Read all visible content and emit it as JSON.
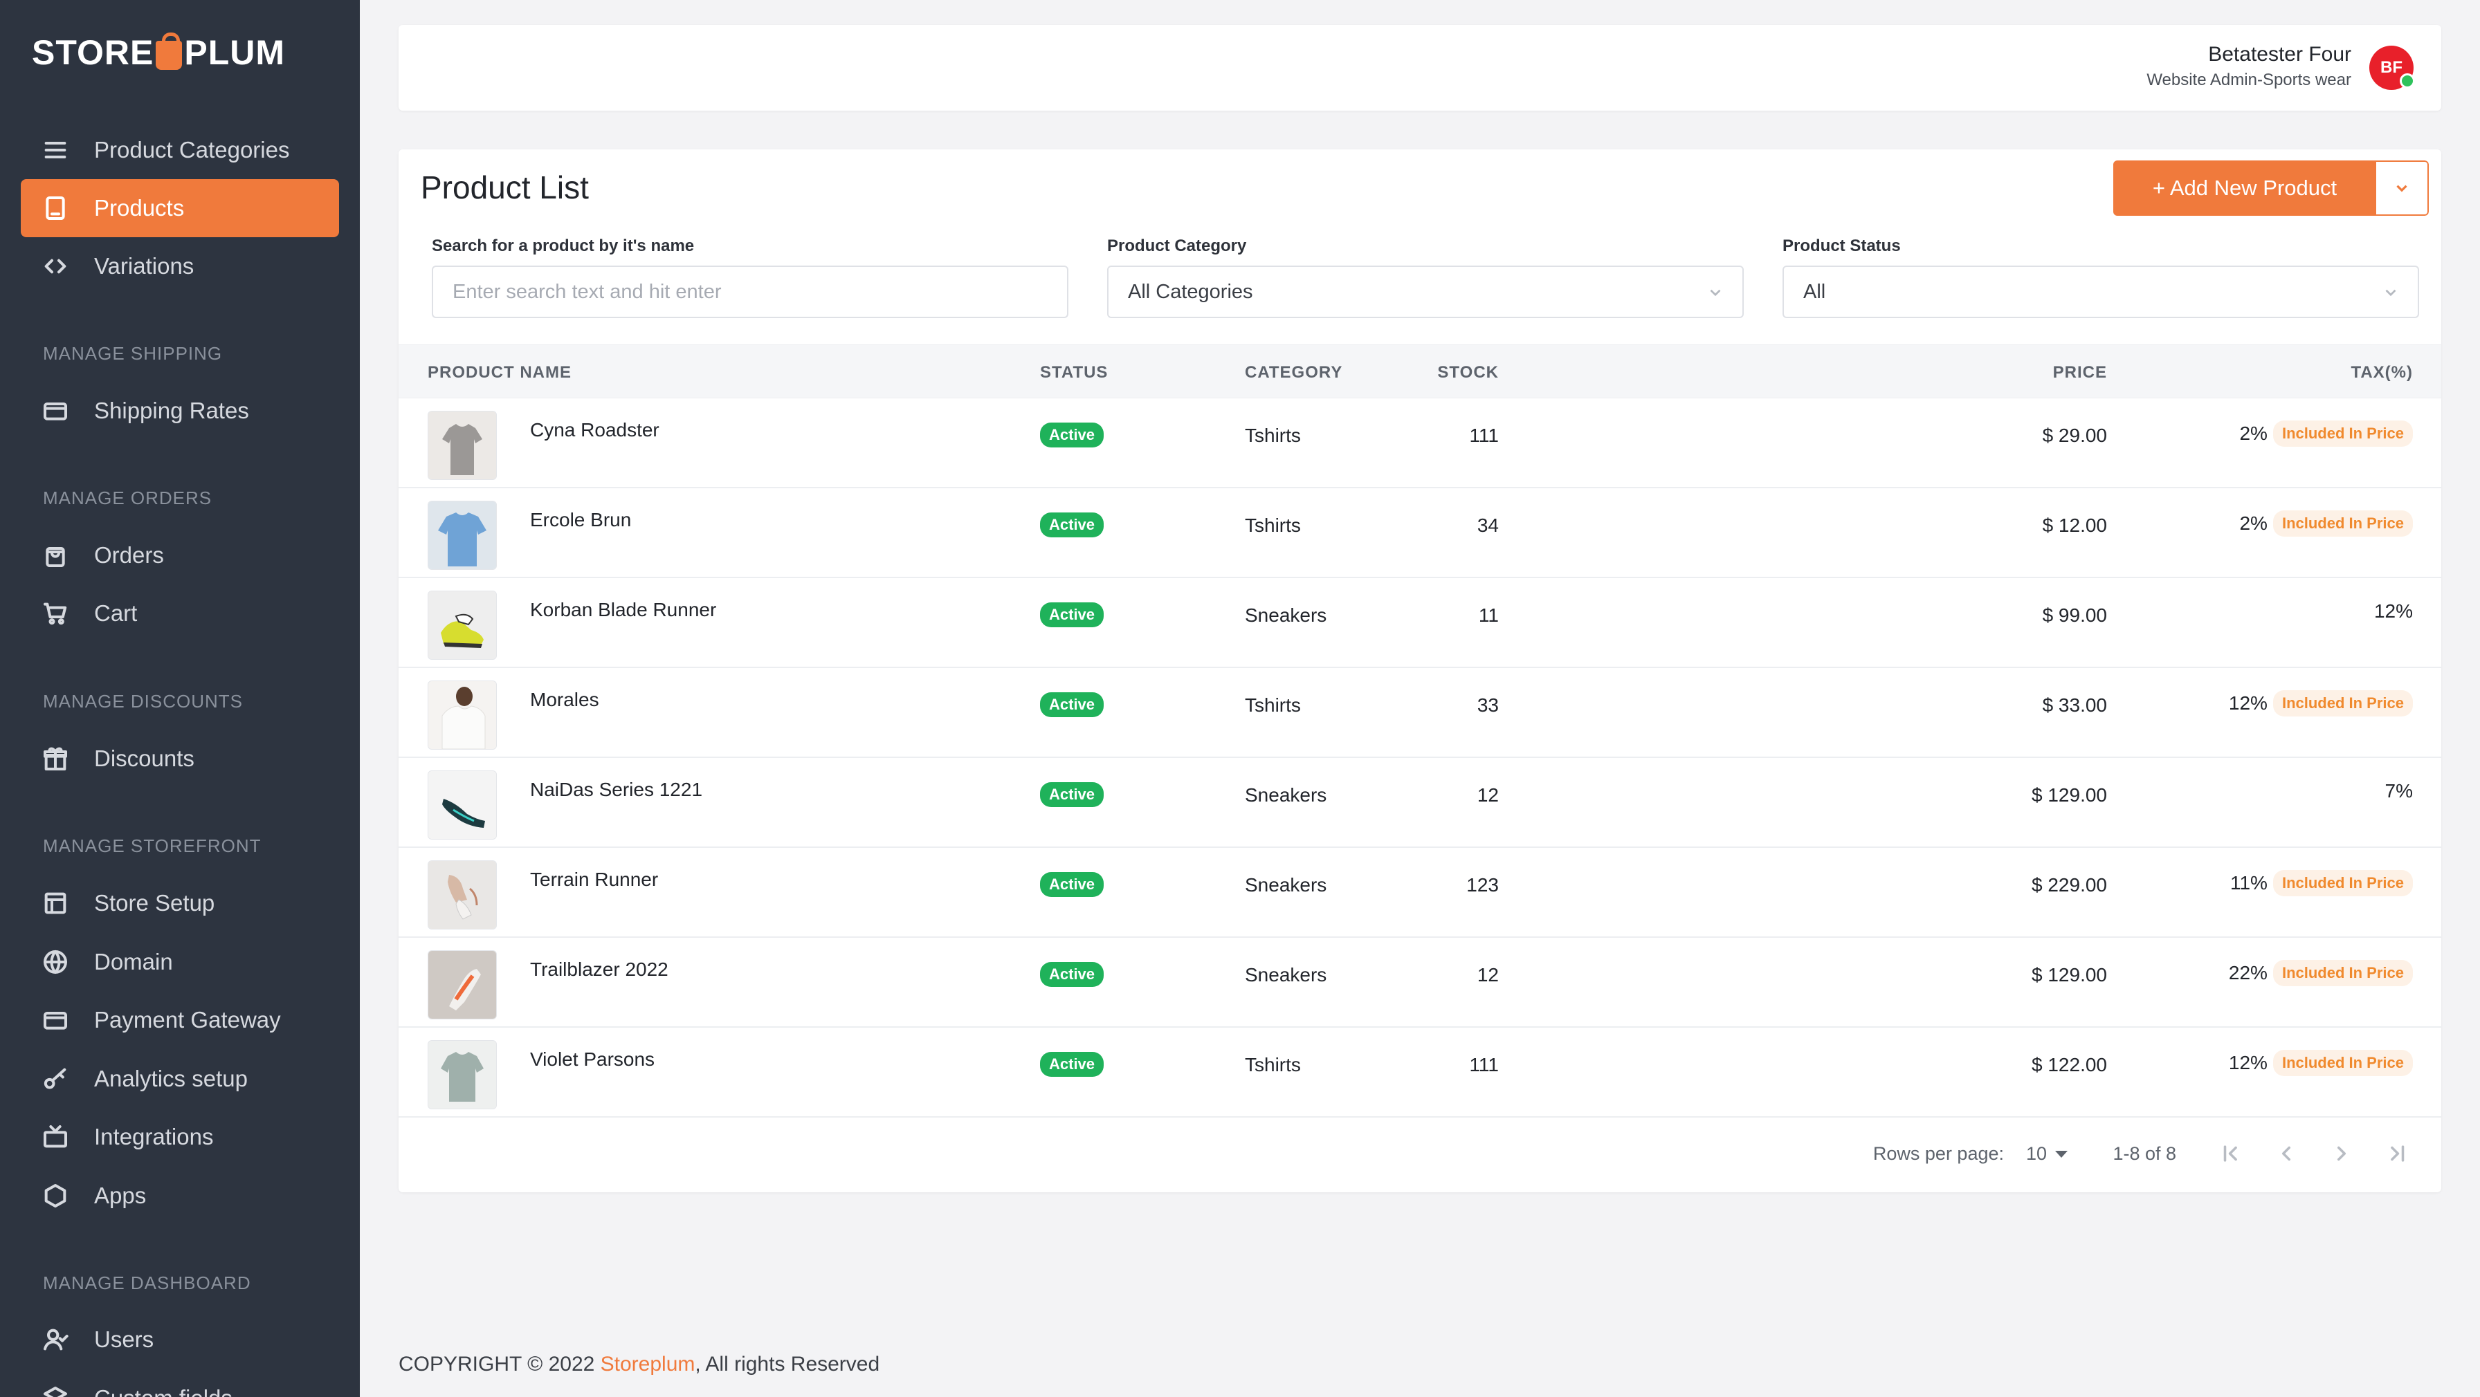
{
  "brand": {
    "name_left": "STORE",
    "name_right": "PLUM"
  },
  "sidebar": {
    "items": [
      {
        "label": "Product Categories",
        "icon": "menu-icon"
      },
      {
        "label": "Products",
        "icon": "tablet-icon",
        "active": true
      },
      {
        "label": "Variations",
        "icon": "code-icon"
      },
      {
        "label": "Shipping Rates",
        "icon": "card-icon"
      },
      {
        "label": "Orders",
        "icon": "bag-icon"
      },
      {
        "label": "Cart",
        "icon": "cart-icon"
      },
      {
        "label": "Discounts",
        "icon": "gift-icon"
      },
      {
        "label": "Store Setup",
        "icon": "layout-icon"
      },
      {
        "label": "Domain",
        "icon": "globe-icon"
      },
      {
        "label": "Payment Gateway",
        "icon": "card-icon"
      },
      {
        "label": "Analytics setup",
        "icon": "key-icon"
      },
      {
        "label": "Integrations",
        "icon": "tv-icon"
      },
      {
        "label": "Apps",
        "icon": "hexagon-icon"
      },
      {
        "label": "Users",
        "icon": "user-icon"
      },
      {
        "label": "Custom fields",
        "icon": "layers-icon"
      }
    ],
    "sections": {
      "shipping": "MANAGE SHIPPING",
      "orders": "MANAGE ORDERS",
      "discounts": "MANAGE DISCOUNTS",
      "storefront": "MANAGE STOREFRONT",
      "dashboard": "MANAGE DASHBOARD"
    }
  },
  "user": {
    "name": "Betatester Four",
    "role": "Website Admin-Sports wear",
    "initials": "BF"
  },
  "main": {
    "title": "Product List",
    "add_button": "+ Add New Product",
    "filters": {
      "search_label": "Search for a product by it's name",
      "search_placeholder": "Enter search text and hit enter",
      "category_label": "Product Category",
      "category_value": "All Categories",
      "status_label": "Product Status",
      "status_value": "All"
    },
    "columns": [
      "PRODUCT NAME",
      "STATUS",
      "CATEGORY",
      "STOCK",
      "PRICE",
      "TAX(%)"
    ],
    "rows": [
      {
        "name": "Cyna Roadster",
        "status": "Active",
        "category": "Tshirts",
        "stock": "111",
        "price": "$ 29.00",
        "tax": "2%",
        "included": "Included In Price",
        "thumb": "tshirt-grey"
      },
      {
        "name": "Ercole Brun",
        "status": "Active",
        "category": "Tshirts",
        "stock": "34",
        "price": "$ 12.00",
        "tax": "2%",
        "included": "Included In Price",
        "thumb": "tshirt-blue"
      },
      {
        "name": "Korban Blade Runner",
        "status": "Active",
        "category": "Sneakers",
        "stock": "11",
        "price": "$ 99.00",
        "tax": "12%",
        "included": "",
        "thumb": "sneaker-yellow"
      },
      {
        "name": "Morales",
        "status": "Active",
        "category": "Tshirts",
        "stock": "33",
        "price": "$ 33.00",
        "tax": "12%",
        "included": "Included In Price",
        "thumb": "tshirt-white"
      },
      {
        "name": "NaiDas Series 1221",
        "status": "Active",
        "category": "Sneakers",
        "stock": "12",
        "price": "$ 129.00",
        "tax": "7%",
        "included": "",
        "thumb": "sneaker-dark"
      },
      {
        "name": "Terrain Runner",
        "status": "Active",
        "category": "Sneakers",
        "stock": "123",
        "price": "$ 229.00",
        "tax": "11%",
        "included": "Included In Price",
        "thumb": "sneaker-white"
      },
      {
        "name": "Trailblazer 2022",
        "status": "Active",
        "category": "Sneakers",
        "stock": "12",
        "price": "$ 129.00",
        "tax": "22%",
        "included": "Included In Price",
        "thumb": "sneaker-orange"
      },
      {
        "name": "Violet Parsons",
        "status": "Active",
        "category": "Tshirts",
        "stock": "111",
        "price": "$ 122.00",
        "tax": "12%",
        "included": "Included In Price",
        "thumb": "tshirt-sage"
      }
    ],
    "pagination": {
      "rows_per_page_label": "Rows per page:",
      "rows_per_page": "10",
      "range": "1-8 of 8"
    }
  },
  "footer": {
    "prefix": "COPYRIGHT © 2022 ",
    "brand": "Storeplum",
    "suffix": ", All rights Reserved"
  },
  "colors": {
    "accent": "#f07a3c",
    "sidebar": "#2d3440",
    "active_badge": "#1fb25a"
  }
}
